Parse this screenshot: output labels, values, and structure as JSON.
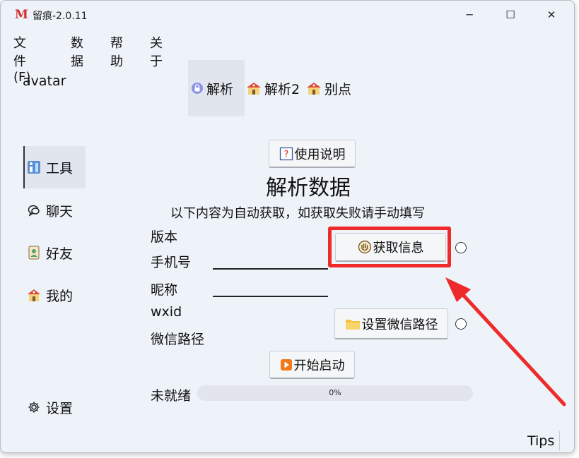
{
  "window": {
    "logo": "M",
    "title": "留痕-2.0.11",
    "controls": {
      "minimize": "─",
      "maximize": "☐",
      "close": "✕"
    }
  },
  "menu": [
    "文件(F)",
    "数据",
    "帮助",
    "关于"
  ],
  "sidebar": {
    "avatar_label": "avatar",
    "items": [
      {
        "label": "工具",
        "icon": "tools-icon",
        "active": true
      },
      {
        "label": "聊天",
        "icon": "chat-icon",
        "active": false
      },
      {
        "label": "好友",
        "icon": "contacts-icon",
        "active": false
      },
      {
        "label": "我的",
        "icon": "house-icon",
        "active": false
      }
    ],
    "settings_label": "设置"
  },
  "tabs": [
    {
      "label": "解析",
      "icon": "lock-icon",
      "active": true
    },
    {
      "label": "解析2",
      "icon": "house-icon",
      "active": false
    },
    {
      "label": "别点",
      "icon": "house-icon",
      "active": false
    }
  ],
  "main": {
    "help_button": "使用说明",
    "heading": "解析数据",
    "subtitle": "以下内容为自动获取，如获取失败请手动填写",
    "fields": {
      "version": "版本",
      "phone": "手机号",
      "nickname": "昵称",
      "wxid": "wxid",
      "wechat_path": "微信路径"
    },
    "get_info_button": "获取信息",
    "set_path_button": "设置微信路径",
    "start_button": "开始启动",
    "status": "未就绪",
    "progress_text": "0%",
    "progress_value": 0
  },
  "footer": {
    "tips": "Tips"
  },
  "colors": {
    "highlight": "#ee2a2a",
    "arrow": "#ee2a2a",
    "start_icon": "#f07a1a",
    "folder_icon": "#f5c242"
  }
}
